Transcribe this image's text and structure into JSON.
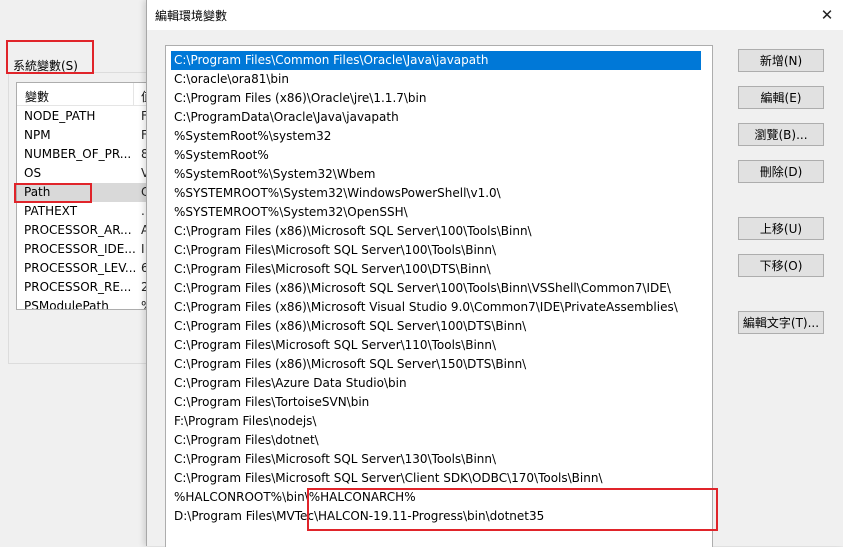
{
  "background_window": {
    "group_label": "系統變數(S)",
    "columns": {
      "name": "變數",
      "value": "值"
    },
    "rows": [
      {
        "name": "NODE_PATH",
        "value": "F"
      },
      {
        "name": "NPM",
        "value": "F"
      },
      {
        "name": "NUMBER_OF_PR...",
        "value": "8"
      },
      {
        "name": "OS",
        "value": "V"
      },
      {
        "name": "Path",
        "value": "C"
      },
      {
        "name": "PATHEXT",
        "value": "."
      },
      {
        "name": "PROCESSOR_AR...",
        "value": "A"
      },
      {
        "name": "PROCESSOR_IDE...",
        "value": "I"
      },
      {
        "name": "PROCESSOR_LEV...",
        "value": "6"
      },
      {
        "name": "PROCESSOR_RE...",
        "value": "2"
      },
      {
        "name": "PSModulePath",
        "value": "%"
      }
    ]
  },
  "dialog": {
    "title": "編輯環境變數",
    "close_glyph": "✕",
    "paths": [
      "C:\\Program Files\\Common Files\\Oracle\\Java\\javapath",
      "C:\\oracle\\ora81\\bin",
      "C:\\Program Files (x86)\\Oracle\\jre\\1.1.7\\bin",
      "C:\\ProgramData\\Oracle\\Java\\javapath",
      "%SystemRoot%\\system32",
      "%SystemRoot%",
      "%SystemRoot%\\System32\\Wbem",
      "%SYSTEMROOT%\\System32\\WindowsPowerShell\\v1.0\\",
      "%SYSTEMROOT%\\System32\\OpenSSH\\",
      "C:\\Program Files (x86)\\Microsoft SQL Server\\100\\Tools\\Binn\\",
      "C:\\Program Files\\Microsoft SQL Server\\100\\Tools\\Binn\\",
      "C:\\Program Files\\Microsoft SQL Server\\100\\DTS\\Binn\\",
      "C:\\Program Files (x86)\\Microsoft SQL Server\\100\\Tools\\Binn\\VSShell\\Common7\\IDE\\",
      "C:\\Program Files (x86)\\Microsoft Visual Studio 9.0\\Common7\\IDE\\PrivateAssemblies\\",
      "C:\\Program Files (x86)\\Microsoft SQL Server\\100\\DTS\\Binn\\",
      "C:\\Program Files\\Microsoft SQL Server\\110\\Tools\\Binn\\",
      "C:\\Program Files (x86)\\Microsoft SQL Server\\150\\DTS\\Binn\\",
      "C:\\Program Files\\Azure Data Studio\\bin",
      "C:\\Program Files\\TortoiseSVN\\bin",
      "F:\\Program Files\\nodejs\\",
      "C:\\Program Files\\dotnet\\",
      "C:\\Program Files\\Microsoft SQL Server\\130\\Tools\\Binn\\",
      "C:\\Program Files\\Microsoft SQL Server\\Client SDK\\ODBC\\170\\Tools\\Binn\\",
      "%HALCONROOT%\\bin\\%HALCONARCH%",
      "D:\\Program Files\\MVTec\\HALCON-19.11-Progress\\bin\\dotnet35"
    ],
    "selected_index": 0,
    "buttons": {
      "new": "新增(N)",
      "edit": "編輯(E)",
      "browse": "瀏覽(B)...",
      "delete": "刪除(D)",
      "move_up": "上移(U)",
      "move_down": "下移(O)",
      "edit_text": "編輯文字(T)..."
    }
  }
}
